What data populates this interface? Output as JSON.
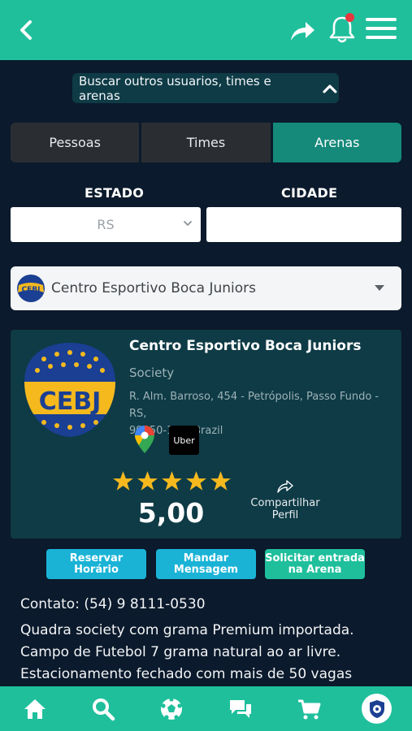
{
  "header": {
    "back_icon": "chevron-left-icon",
    "share_icon": "share-arrow-icon",
    "notification_icon": "bell-icon",
    "menu_icon": "hamburger-menu-icon"
  },
  "search": {
    "toggle_label": "Buscar outros usuarios, times e arenas",
    "toggle_icon": "chevron-up-icon"
  },
  "tabs": [
    {
      "label": "Pessoas",
      "active": false
    },
    {
      "label": "Times",
      "active": false
    },
    {
      "label": "Arenas",
      "active": true
    }
  ],
  "filters": {
    "estado_label": "ESTADO",
    "estado_value": "RS",
    "cidade_label": "CIDADE",
    "cidade_value": ""
  },
  "arena_select": {
    "value": "Centro Esportivo Boca Juniors"
  },
  "arena": {
    "logo_text": "CEBJ",
    "name": "Centro Esportivo Boca Juniors",
    "type": "Society",
    "address_line1": "R. Alm. Barroso, 454 - Petrópolis, Passo Fundo - RS,",
    "address_line2": "99050-150, Brazil",
    "maps_icon": "google-maps-icon",
    "uber_label": "Uber",
    "stars": 5,
    "rating": "5,00",
    "share_label_1": "Compartilhar",
    "share_label_2": "Perfil"
  },
  "actions": {
    "reserve": "Reservar Horário",
    "message_1": "Mandar",
    "message_2": "Mensagem",
    "request_1": "Solicitar entrada",
    "request_2": "na Arena"
  },
  "info": {
    "contact": "Contato: (54) 9 8111-0530",
    "line1": "Quadra society com grama Premium importada.",
    "line2": "Campo de Futebol 7 grama natural ao ar livre.",
    "line3": "Estacionamento fechado com mais de 50 vagas"
  },
  "bottom_nav": [
    "home-icon",
    "search-icon",
    "soccer-ball-icon",
    "chat-icon",
    "cart-icon",
    "profile-avatar-icon"
  ],
  "colors": {
    "accent": "#1fbf9c",
    "background": "#0b1a2c",
    "card": "#0e3b46",
    "active_tab": "#15897a",
    "button_blue": "#1ab3d6",
    "star": "#f5b91e",
    "notification_dot": "#e8363f"
  }
}
